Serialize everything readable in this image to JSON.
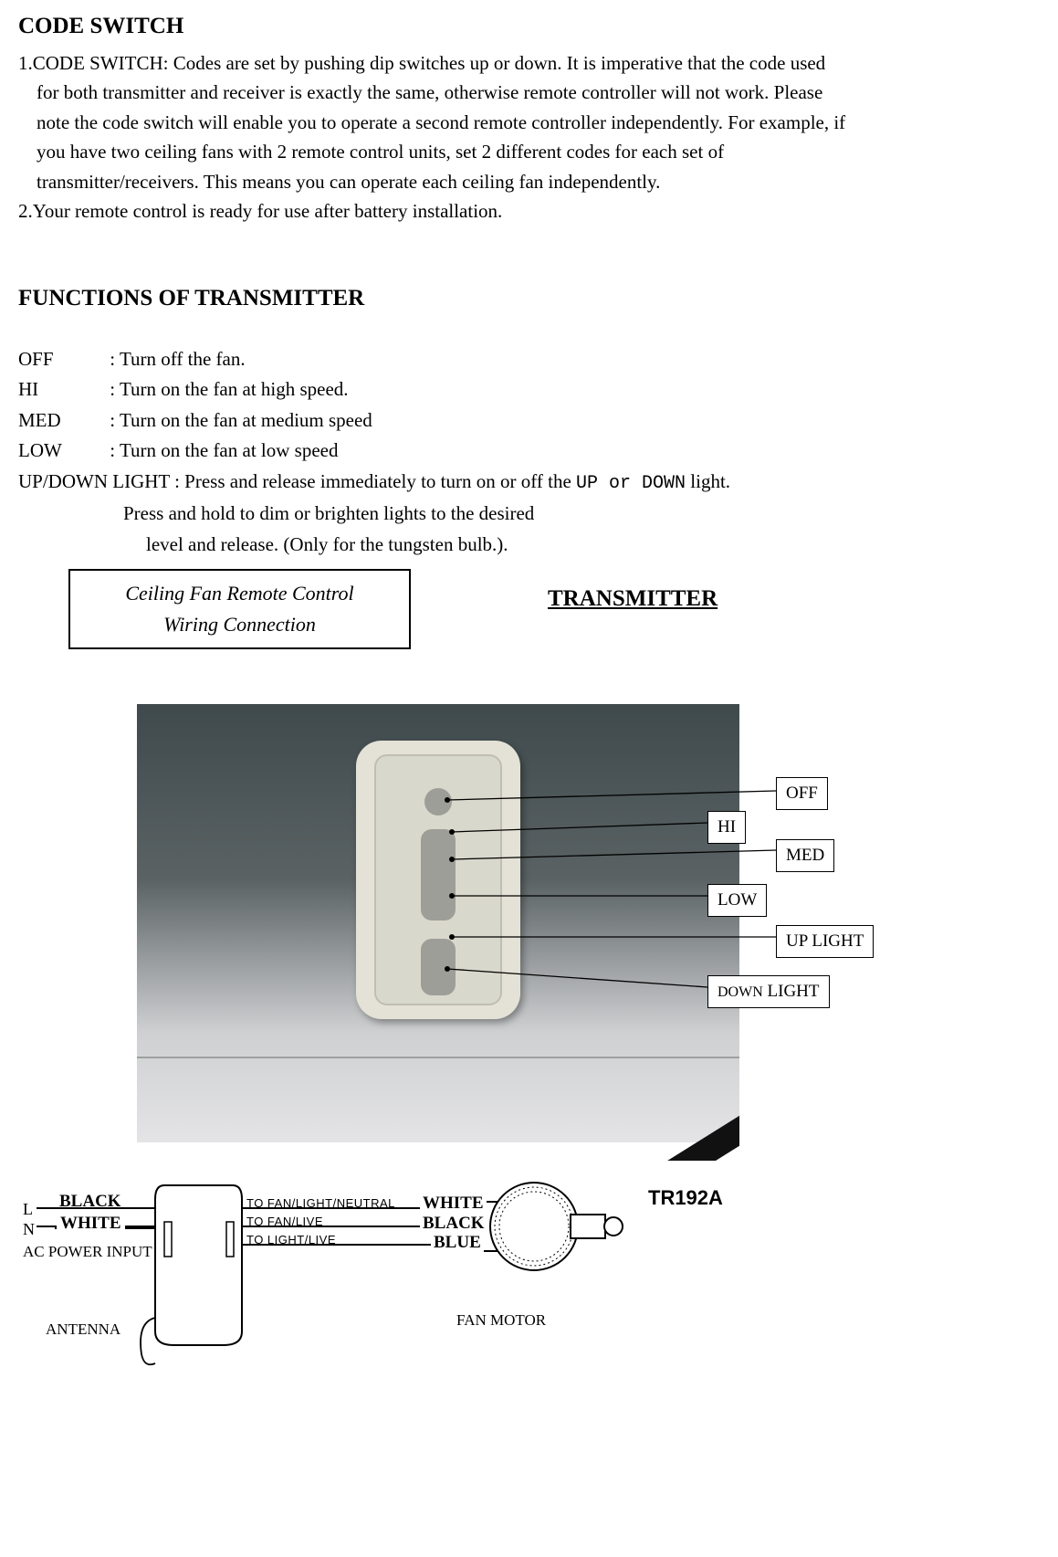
{
  "sections": {
    "code_switch": {
      "title": "CODE SWITCH",
      "item1_lead": "1.CODE SWITCH: Codes are set by pushing dip switches up or down. It is imperative that the code used",
      "item1_l2": "for both transmitter and receiver is exactly the same, otherwise remote controller will not work. Please",
      "item1_l3": "note the code switch will enable you to operate a second remote controller independently. For example, if",
      "item1_l4": "you have two ceiling fans with 2 remote control units, set 2 different codes for each set of",
      "item1_l5": "transmitter/receivers. This means you can operate each ceiling fan independently.",
      "item2": "2.Your remote control is ready for use after battery installation."
    },
    "functions": {
      "title": "FUNCTIONS OF TRANSMITTER",
      "lines": {
        "off_key": "OFF",
        "off_val": ": Turn off the fan.",
        "hi_key": "HI",
        "hi_val": ": Turn on the fan at high speed.",
        "med_key": "MED",
        "med_val": ": Turn on the fan at medium speed",
        "low_key": "LOW",
        "low_val": ": Turn on the fan at low speed",
        "updown_lead": "UP/DOWN LIGHT    : Press and release immediately to turn on or off the ",
        "updown_mono": "UP or DOWN",
        "updown_tail": " light.",
        "updown_l2": "Press and hold to dim or brighten lights to the desired",
        "updown_l3": "level and release. (Only for the tungsten bulb.)."
      }
    },
    "wiring_box": {
      "l1": "Ceiling Fan Remote Control",
      "l2": "Wiring Connection"
    },
    "transmitter_heading": "TRANSMITTER",
    "callouts": {
      "off": "OFF",
      "hi": "HI",
      "med": "MED",
      "low": "LOW",
      "up_light": "UP LIGHT",
      "down_light_small": "DOWN",
      "down_light_big": " LIGHT"
    },
    "wiring_diagram": {
      "left_black": "BLACK",
      "left_white": "WHITE",
      "L": "L",
      "N": "N",
      "ac_power": "AC POWER INPUT",
      "antenna": "ANTENNA",
      "to_neutral": "TO FAN/LIGHT/NEUTRAL",
      "to_fan_live": "TO FAN/LIVE",
      "to_light_live": "TO LIGHT/LIVE",
      "right_white": "WHITE",
      "right_black": "BLACK",
      "right_blue": "BLUE",
      "fan_motor": "FAN MOTOR"
    },
    "model": "TR192A"
  }
}
